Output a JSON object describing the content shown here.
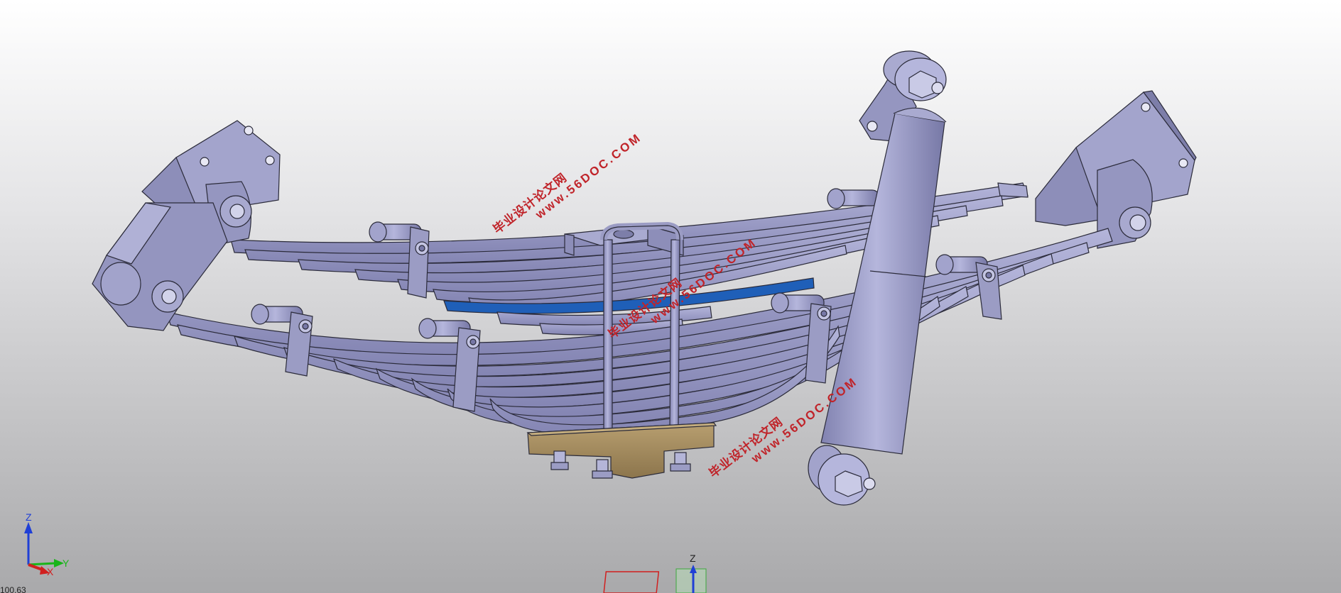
{
  "watermarks": [
    {
      "cn": "毕业设计论文网",
      "url": "www.56DOC.COM"
    },
    {
      "cn": "毕业设计论文网",
      "url": "www.56DOC.COM"
    },
    {
      "cn": "毕业设计论文网",
      "url": "www.56DOC.COM"
    }
  ],
  "axis_triad": {
    "z_label": "Z",
    "y_label": "Y",
    "x_label": "X"
  },
  "compass": {
    "z_label": "Z"
  },
  "colors": {
    "background_top": "#ffffff",
    "background_bottom": "#a9a9ab",
    "part": "#9b9cc4",
    "part_dark": "#6f70a0",
    "accent_leaf": "#1f5fb8",
    "pad": "#a48d60",
    "watermark": "#c0242a"
  },
  "status": {
    "scale_partial": "100.63"
  }
}
